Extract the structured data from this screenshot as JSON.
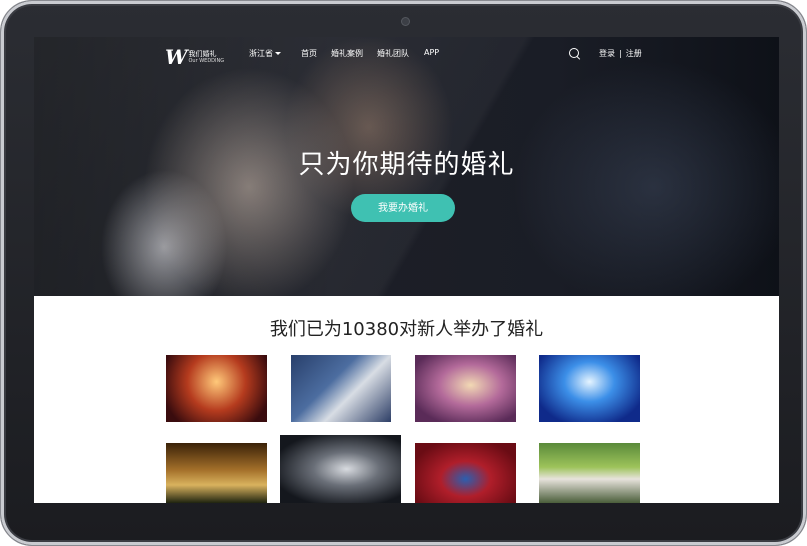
{
  "nav": {
    "logo_cn": "我们婚礼",
    "logo_en": "Our WEDDING",
    "region": "浙江省",
    "links": [
      "首页",
      "婚礼案例",
      "婚礼团队",
      "APP"
    ],
    "login": "登录",
    "separator": "|",
    "register": "注册"
  },
  "hero": {
    "title": "只为你期待的婚礼",
    "cta": "我要办婚礼"
  },
  "section": {
    "title": "我们已为10380对新人举办了婚礼"
  },
  "colors": {
    "accent": "#3fc1b2"
  },
  "icons": {
    "search": "search-icon"
  }
}
